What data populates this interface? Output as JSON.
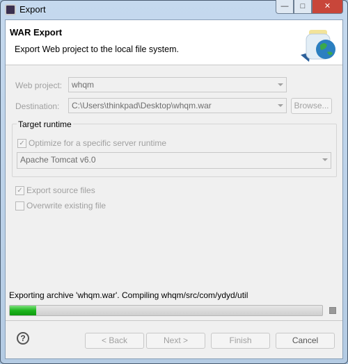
{
  "window": {
    "title": "Export",
    "minimize": "—",
    "maximize": "□",
    "close": "✕"
  },
  "header": {
    "title": "WAR Export",
    "description": "Export Web project to the local file system.",
    "icon": "war-export-jar-globe-icon"
  },
  "form": {
    "web_project_label": "Web project:",
    "web_project_value": "whqm",
    "destination_label": "Destination:",
    "destination_value": "C:\\Users\\thinkpad\\Desktop\\whqm.war",
    "browse_label": "Browse..."
  },
  "target_runtime": {
    "label": "Target runtime",
    "optimize_label": "Optimize for a specific server runtime",
    "optimize_checked": true,
    "runtime_value": "Apache Tomcat v6.0"
  },
  "options": {
    "export_source_label": "Export source files",
    "export_source_checked": true,
    "overwrite_label": "Overwrite existing file",
    "overwrite_checked": false
  },
  "progress": {
    "status": "Exporting archive 'whqm.war'. Compiling whqm/src/com/ydyd/util",
    "percent": 8.5,
    "color": "#1db61d"
  },
  "buttons": {
    "help": "?",
    "back": "< Back",
    "next": "Next >",
    "finish": "Finish",
    "cancel": "Cancel"
  }
}
